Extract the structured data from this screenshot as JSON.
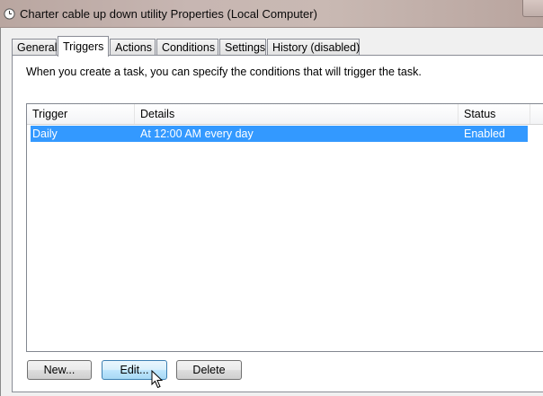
{
  "window": {
    "title": "Charter cable up down utility Properties (Local Computer)",
    "icon": "clock-icon"
  },
  "tabs": [
    {
      "label": "General",
      "active": false
    },
    {
      "label": "Triggers",
      "active": true
    },
    {
      "label": "Actions",
      "active": false
    },
    {
      "label": "Conditions",
      "active": false
    },
    {
      "label": "Settings",
      "active": false
    },
    {
      "label": "History (disabled)",
      "active": false
    }
  ],
  "panel": {
    "description": "When you create a task, you can specify the conditions that will trigger the task."
  },
  "list": {
    "columns": [
      "Trigger",
      "Details",
      "Status"
    ],
    "rows": [
      {
        "trigger": "Daily",
        "details": "At 12:00 AM every day",
        "status": "Enabled",
        "selected": true
      }
    ]
  },
  "buttons": {
    "new_label": "New...",
    "edit_label": "Edit...",
    "delete_label": "Delete"
  },
  "colors": {
    "selection": "#3399ff",
    "button_hover_border": "#3c7fb1"
  }
}
